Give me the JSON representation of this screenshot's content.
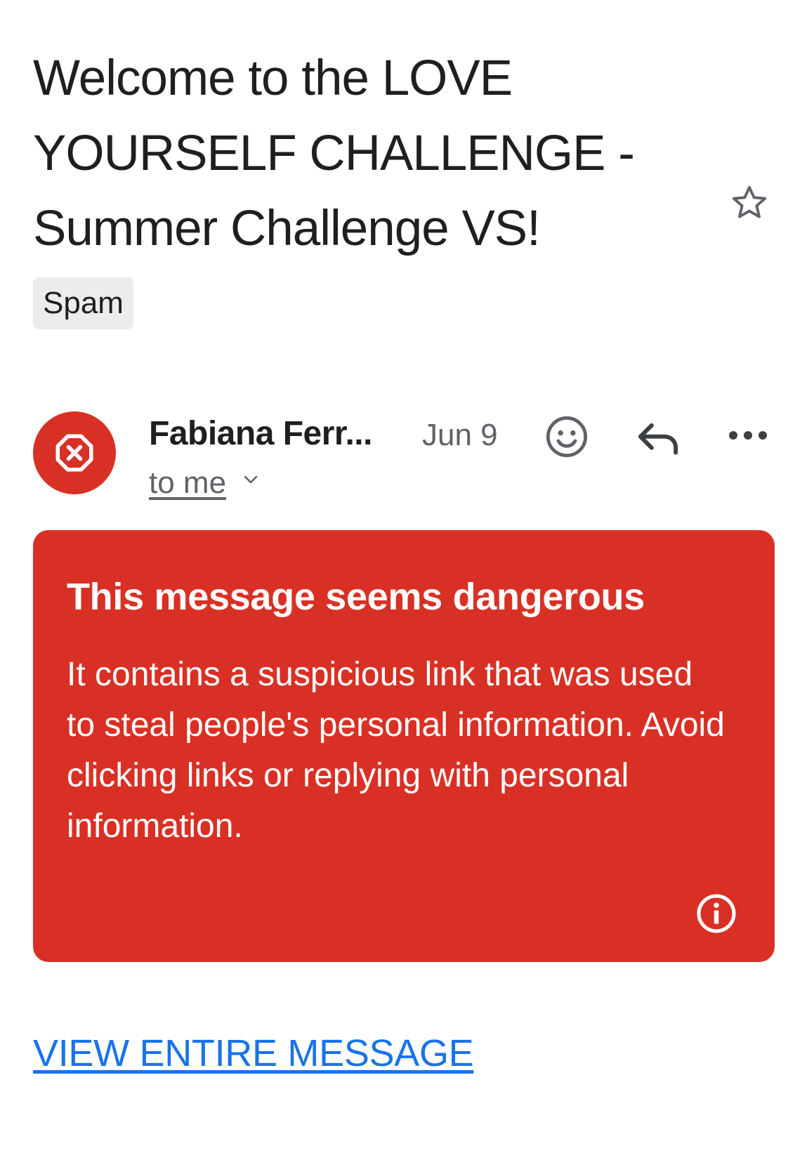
{
  "email": {
    "subject": "Welcome to the LOVE YOURSELF CHALLENGE - Summer Challenge VS!",
    "label_chip": "Spam",
    "sender_name": "Fabiana Ferr...",
    "date": "Jun 9",
    "recipient_text": "to me"
  },
  "icons": {
    "star": "star-outline-icon",
    "avatar": "danger-octagon-icon",
    "emoji": "add-reaction-icon",
    "reply": "reply-icon",
    "more": "more-horizontal-icon",
    "info": "info-icon",
    "recipients_toggle": "chevron-down-icon"
  },
  "warning": {
    "title": "This message seems dangerous",
    "body": "It contains a suspicious link that was used to steal people's personal information. Avoid clicking links or replying with personal information."
  },
  "actions": {
    "view_entire_message": "VIEW ENTIRE MESSAGE"
  },
  "colors": {
    "danger": "#d93025",
    "link": "#1a73e8",
    "muted": "#5f6368",
    "chip_bg": "#ececec"
  }
}
